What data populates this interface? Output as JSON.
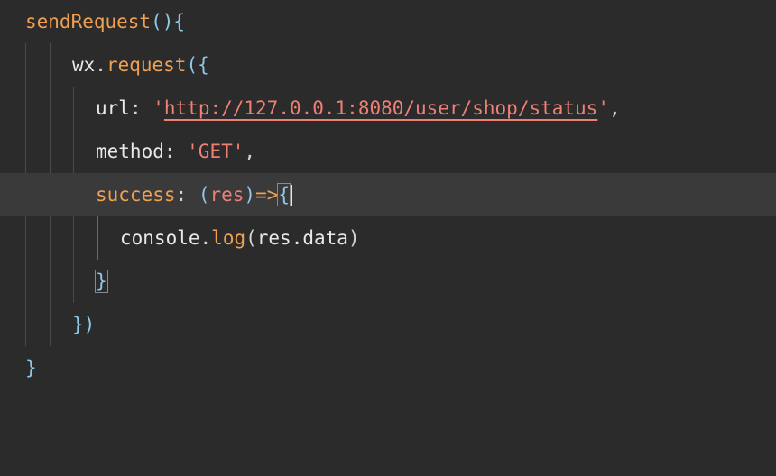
{
  "code": {
    "line1": {
      "name": "sendRequest",
      "paren": "()",
      "brace": "{"
    },
    "line2": {
      "obj": "wx",
      "dot": ".",
      "method": "request",
      "open": "({"
    },
    "line3": {
      "key": "url",
      "colon": ": ",
      "q1": "'",
      "url": "http://127.0.0.1:8080/user/shop/status",
      "q2": "'",
      "comma": ","
    },
    "line4": {
      "key": "method",
      "colon": ": ",
      "value": "'GET'",
      "comma": ","
    },
    "line5": {
      "key": "success",
      "colon": ": ",
      "open_paren": "(",
      "param": "res",
      "close_paren": ")",
      "arrow": "=>",
      "brace": "{"
    },
    "line6": {
      "obj": "console",
      "dot": ".",
      "method": "log",
      "args_open": "(",
      "args": "res.data",
      "args_close": ")"
    },
    "line7": {
      "brace": "}"
    },
    "line8": {
      "close": "})"
    },
    "line9": {
      "brace": "}"
    }
  }
}
